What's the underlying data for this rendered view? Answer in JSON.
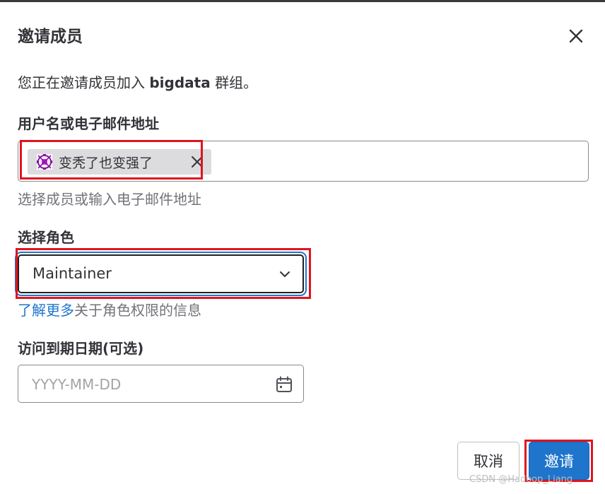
{
  "modal": {
    "title": "邀请成员",
    "intro_prefix": "您正在邀请成员加入 ",
    "intro_group": "bigdata",
    "intro_suffix": " 群组。"
  },
  "members": {
    "label": "用户名或电子邮件地址",
    "token_label": "变秃了也变强了",
    "help": "选择成员或输入电子邮件地址"
  },
  "role": {
    "label": "选择角色",
    "selected": "Maintainer",
    "learn_link": "了解更多",
    "learn_suffix": "关于角色权限的信息"
  },
  "expiry": {
    "label": "访问到期日期(可选)",
    "placeholder": "YYYY-MM-DD"
  },
  "footer": {
    "cancel_label": "取消",
    "invite_label": "邀请"
  },
  "watermark": "CSDN @Hadoop_Liang",
  "colors": {
    "accent": "#1f75cb",
    "highlight": "#e0141e",
    "token_bg": "#dcdcde"
  },
  "icons": [
    "close-icon",
    "avatar-identicon",
    "remove-icon",
    "chevron-down-icon",
    "calendar-icon"
  ]
}
